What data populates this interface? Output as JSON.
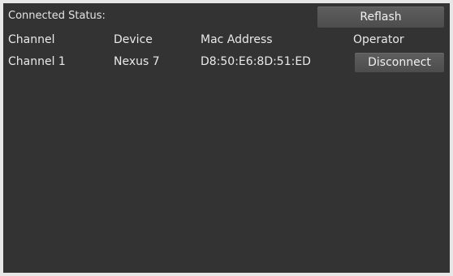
{
  "status": {
    "label": "Connected Status:",
    "refresh_label": "Reflash"
  },
  "table": {
    "headers": {
      "channel": "Channel",
      "device": "Device",
      "mac": "Mac Address",
      "operator": "Operator"
    },
    "rows": [
      {
        "channel": "Channel 1",
        "device": "Nexus 7",
        "mac": "D8:50:E6:8D:51:ED",
        "action": "Disconnect"
      }
    ]
  },
  "colors": {
    "background": "#333333",
    "button": "#565656",
    "text": "#e9e9e9"
  }
}
